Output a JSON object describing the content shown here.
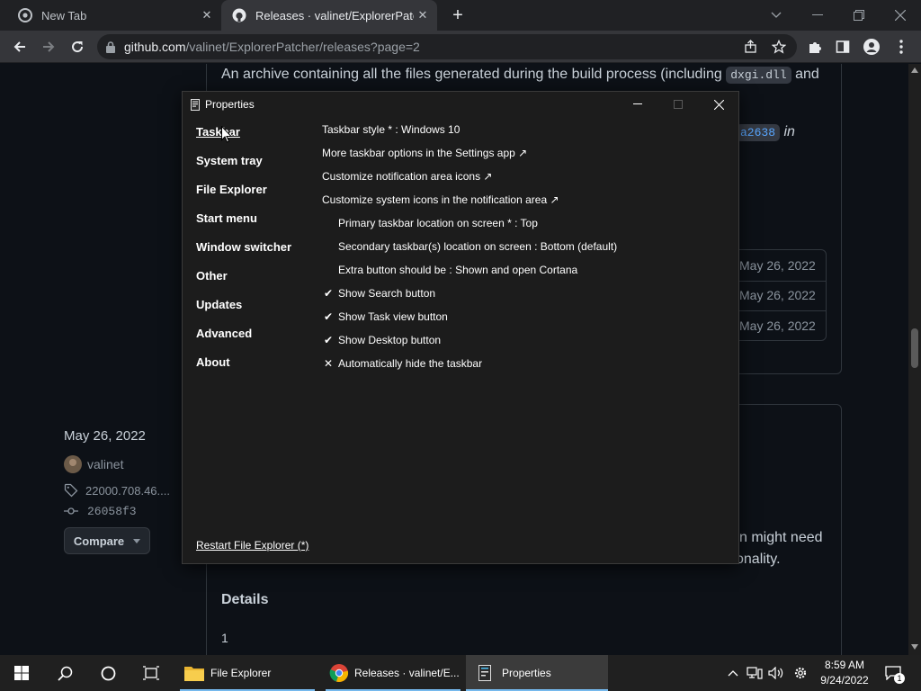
{
  "browser": {
    "tabs": [
      {
        "title": "New Tab",
        "icon": "chrome-icon"
      },
      {
        "title": "Releases · valinet/ExplorerPatcher",
        "icon": "github-icon"
      }
    ],
    "url_host": "github.com",
    "url_path": "/valinet/ExplorerPatcher/releases?page=2"
  },
  "page": {
    "line1_text": "An archive containing all the files generated during the build process (including",
    "line1_code": "dxgi.dll",
    "line1_tail": "and",
    "commit_code": "a2638",
    "commit_tail": "in",
    "release_date": "May 26, 2022",
    "author": "valinet",
    "tag": "22000.708.46....",
    "commit": "26058f3",
    "compare_label": "Compare",
    "asset_dates": [
      "May 26, 2022",
      "May 26, 2022",
      "May 26, 2022"
    ],
    "body_fragment_1": "n might need",
    "body_fragment_2": "onality.",
    "details_heading": "Details",
    "details_first": "1"
  },
  "dialog": {
    "title": "Properties",
    "nav": [
      "Taskbar",
      "System tray",
      "File Explorer",
      "Start menu",
      "Window switcher",
      "Other",
      "Updates",
      "Advanced",
      "About"
    ],
    "active_nav": "Taskbar",
    "options": [
      {
        "mark": "",
        "text": "Taskbar style * : Windows 10",
        "indent": false
      },
      {
        "mark": "",
        "text": "More taskbar options in the Settings app ↗",
        "indent": false
      },
      {
        "mark": "",
        "text": "Customize notification area icons ↗",
        "indent": false
      },
      {
        "mark": "",
        "text": "Customize system icons in the notification area ↗",
        "indent": false
      },
      {
        "mark": "",
        "text": "Primary taskbar location on screen * : Top",
        "indent": true
      },
      {
        "mark": "",
        "text": "Secondary taskbar(s) location on screen : Bottom (default)",
        "indent": true
      },
      {
        "mark": "",
        "text": "Extra button should be : Shown and open Cortana",
        "indent": true
      },
      {
        "mark": "✔",
        "text": "Show Search button",
        "indent": true
      },
      {
        "mark": "✔",
        "text": "Show Task view button",
        "indent": true
      },
      {
        "mark": "✔",
        "text": "Show Desktop button",
        "indent": true
      },
      {
        "mark": "✕",
        "text": "Automatically hide the taskbar",
        "indent": true
      }
    ],
    "restart_link": "Restart File Explorer (*)"
  },
  "taskbar": {
    "apps": [
      {
        "label": "File Explorer",
        "icon": "folder-icon"
      },
      {
        "label": "Releases · valinet/E...",
        "icon": "chrome-icon"
      },
      {
        "label": "Properties",
        "icon": "properties-icon"
      }
    ],
    "time": "8:59 AM",
    "date": "9/24/2022",
    "notification_count": "1"
  },
  "colors": {
    "accent_link": "#58a6ff",
    "taskbar_underline": "#76b9ed"
  }
}
